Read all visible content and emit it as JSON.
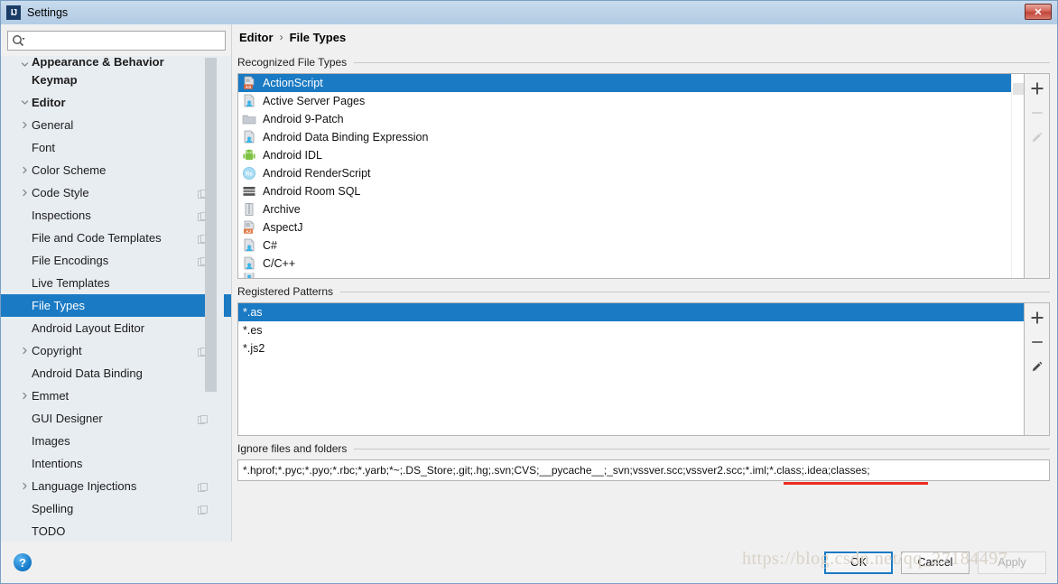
{
  "window": {
    "title": "Settings",
    "app_icon": "IJ",
    "close_label": "✕"
  },
  "search": {
    "value": "",
    "placeholder": "",
    "icon": "search-icon"
  },
  "sidebar": {
    "items": [
      {
        "label": "Appearance & Behavior",
        "indent": 0,
        "arrow": "chevron-down",
        "bold": true,
        "selected": false,
        "copyable": false,
        "clipped": true
      },
      {
        "label": "Keymap",
        "indent": 0,
        "arrow": "none",
        "bold": true,
        "selected": false,
        "copyable": false
      },
      {
        "label": "Editor",
        "indent": 0,
        "arrow": "chevron-down",
        "bold": true,
        "selected": false,
        "copyable": false
      },
      {
        "label": "General",
        "indent": 1,
        "arrow": "chevron-right",
        "bold": false,
        "selected": false,
        "copyable": false
      },
      {
        "label": "Font",
        "indent": 1,
        "arrow": "none",
        "bold": false,
        "selected": false,
        "copyable": false
      },
      {
        "label": "Color Scheme",
        "indent": 1,
        "arrow": "chevron-right",
        "bold": false,
        "selected": false,
        "copyable": false
      },
      {
        "label": "Code Style",
        "indent": 1,
        "arrow": "chevron-right",
        "bold": false,
        "selected": false,
        "copyable": true
      },
      {
        "label": "Inspections",
        "indent": 1,
        "arrow": "none",
        "bold": false,
        "selected": false,
        "copyable": true
      },
      {
        "label": "File and Code Templates",
        "indent": 1,
        "arrow": "none",
        "bold": false,
        "selected": false,
        "copyable": true
      },
      {
        "label": "File Encodings",
        "indent": 1,
        "arrow": "none",
        "bold": false,
        "selected": false,
        "copyable": true
      },
      {
        "label": "Live Templates",
        "indent": 1,
        "arrow": "none",
        "bold": false,
        "selected": false,
        "copyable": false
      },
      {
        "label": "File Types",
        "indent": 1,
        "arrow": "none",
        "bold": false,
        "selected": true,
        "copyable": false
      },
      {
        "label": "Android Layout Editor",
        "indent": 1,
        "arrow": "none",
        "bold": false,
        "selected": false,
        "copyable": false
      },
      {
        "label": "Copyright",
        "indent": 1,
        "arrow": "chevron-right",
        "bold": false,
        "selected": false,
        "copyable": true
      },
      {
        "label": "Android Data Binding",
        "indent": 1,
        "arrow": "none",
        "bold": false,
        "selected": false,
        "copyable": false
      },
      {
        "label": "Emmet",
        "indent": 1,
        "arrow": "chevron-right",
        "bold": false,
        "selected": false,
        "copyable": false
      },
      {
        "label": "GUI Designer",
        "indent": 1,
        "arrow": "none",
        "bold": false,
        "selected": false,
        "copyable": true
      },
      {
        "label": "Images",
        "indent": 1,
        "arrow": "none",
        "bold": false,
        "selected": false,
        "copyable": false
      },
      {
        "label": "Intentions",
        "indent": 1,
        "arrow": "none",
        "bold": false,
        "selected": false,
        "copyable": false
      },
      {
        "label": "Language Injections",
        "indent": 1,
        "arrow": "chevron-right",
        "bold": false,
        "selected": false,
        "copyable": true
      },
      {
        "label": "Spelling",
        "indent": 1,
        "arrow": "none",
        "bold": false,
        "selected": false,
        "copyable": true
      },
      {
        "label": "TODO",
        "indent": 1,
        "arrow": "none",
        "bold": false,
        "selected": false,
        "copyable": false
      }
    ]
  },
  "breadcrumb": {
    "parent": "Editor",
    "separator": "›",
    "current": "File Types"
  },
  "recognized": {
    "title": "Recognized File Types",
    "items": [
      {
        "label": "ActionScript",
        "icon": "actionscript-file-icon",
        "selected": true
      },
      {
        "label": "Active Server Pages",
        "icon": "generic-file-icon",
        "selected": false
      },
      {
        "label": "Android 9-Patch",
        "icon": "folder-icon",
        "selected": false
      },
      {
        "label": "Android Data Binding Expression",
        "icon": "generic-file-icon",
        "selected": false
      },
      {
        "label": "Android IDL",
        "icon": "android-robot-icon",
        "selected": false
      },
      {
        "label": "Android RenderScript",
        "icon": "renderscript-icon",
        "selected": false
      },
      {
        "label": "Android Room SQL",
        "icon": "database-icon",
        "selected": false
      },
      {
        "label": "Archive",
        "icon": "archive-icon",
        "selected": false
      },
      {
        "label": "AspectJ",
        "icon": "aspectj-file-icon",
        "selected": false
      },
      {
        "label": "C#",
        "icon": "generic-file-icon",
        "selected": false
      },
      {
        "label": "C/C++",
        "icon": "generic-file-icon",
        "selected": false
      }
    ],
    "tools": [
      {
        "name": "add",
        "glyph": "+",
        "enabled": true
      },
      {
        "name": "remove",
        "glyph": "−",
        "enabled": false
      },
      {
        "name": "edit",
        "glyph": "pencil",
        "enabled": false
      }
    ]
  },
  "patterns": {
    "title": "Registered Patterns",
    "items": [
      {
        "label": "*.as",
        "selected": true
      },
      {
        "label": "*.es",
        "selected": false
      },
      {
        "label": "*.js2",
        "selected": false
      }
    ],
    "tools": [
      {
        "name": "add",
        "glyph": "+",
        "enabled": true
      },
      {
        "name": "remove",
        "glyph": "−",
        "enabled": true
      },
      {
        "name": "edit",
        "glyph": "pencil",
        "enabled": true
      }
    ]
  },
  "ignore": {
    "title": "Ignore files and folders",
    "value": "*.hprof;*.pyc;*.pyo;*.rbc;*.yarb;*~;.DS_Store;.git;.hg;.svn;CVS;__pycache__;_svn;vssver.scc;vssver2.scc;*.iml;*.class;.idea;classes;",
    "placeholder": "",
    "highlight_color": "#ee2b22"
  },
  "footer": {
    "help_label": "?",
    "ok_label": "OK",
    "cancel_label": "Cancel",
    "apply_label": "Apply",
    "apply_enabled": false
  },
  "watermark": {
    "text": "https://blog.csdn.net/qq_27184497"
  },
  "colors": {
    "accent": "#1a7ac4",
    "sidebar_bg": "#e8edf2",
    "panel_bg": "#f0f0f0",
    "titlebar": "#bdd3e8"
  }
}
